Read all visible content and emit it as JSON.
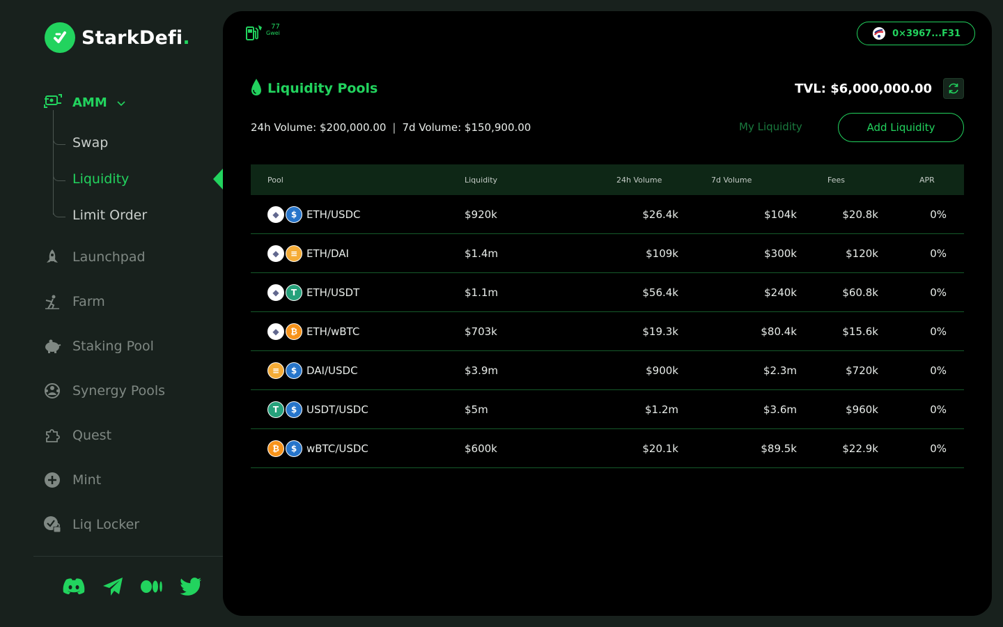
{
  "brand": {
    "name": "StarkDefi",
    "dot": "."
  },
  "sidebar": {
    "amm_label": "AMM",
    "sub_items": [
      {
        "label": "Swap",
        "active": false
      },
      {
        "label": "Liquidity",
        "active": true
      },
      {
        "label": "Limit Order",
        "active": false
      }
    ],
    "items": [
      {
        "label": "Launchpad",
        "icon": "rocket-icon"
      },
      {
        "label": "Farm",
        "icon": "farm-icon"
      },
      {
        "label": "Staking Pool",
        "icon": "piggy-bank-icon"
      },
      {
        "label": "Synergy Pools",
        "icon": "synergy-icon"
      },
      {
        "label": "Quest",
        "icon": "puzzle-icon"
      },
      {
        "label": "Mint",
        "icon": "plus-circle-icon"
      },
      {
        "label": "Liq Locker",
        "icon": "lock-badge-icon"
      }
    ],
    "socials": [
      "discord-icon",
      "telegram-icon",
      "medium-icon",
      "twitter-icon"
    ]
  },
  "header": {
    "gas_value": "77",
    "gas_unit": "Gwei",
    "wallet_address": "0×3967...F31"
  },
  "page": {
    "title": "Liquidity Pools",
    "tvl": "TVL: $6,000,000.00",
    "volume_24h": "24h Volume: $200,000.00",
    "separator": "|",
    "volume_7d": "7d Volume: $150,900.00",
    "my_liquidity": "My Liquidity",
    "add_liquidity": "Add Liquidity"
  },
  "table": {
    "headers": {
      "pool": "Pool",
      "liquidity": "Liquidity",
      "vol24h": "24h Volume",
      "vol7d": "7d Volume",
      "fees": "Fees",
      "apr": "APR"
    },
    "rows": [
      {
        "pool": "ETH/USDC",
        "coins": [
          "eth",
          "usdc"
        ],
        "liquidity": "$920k",
        "vol24h": "$26.4k",
        "vol7d": "$104k",
        "fees": "$20.8k",
        "apr": "0%"
      },
      {
        "pool": "ETH/DAI",
        "coins": [
          "eth",
          "dai"
        ],
        "liquidity": "$1.4m",
        "vol24h": "$109k",
        "vol7d": "$300k",
        "fees": "$120k",
        "apr": "0%"
      },
      {
        "pool": "ETH/USDT",
        "coins": [
          "eth",
          "usdt"
        ],
        "liquidity": "$1.1m",
        "vol24h": "$56.4k",
        "vol7d": "$240k",
        "fees": "$60.8k",
        "apr": "0%"
      },
      {
        "pool": "ETH/wBTC",
        "coins": [
          "eth",
          "wbtc"
        ],
        "liquidity": "$703k",
        "vol24h": "$19.3k",
        "vol7d": "$80.4k",
        "fees": "$15.6k",
        "apr": "0%"
      },
      {
        "pool": "DAI/USDC",
        "coins": [
          "dai",
          "usdc"
        ],
        "liquidity": "$3.9m",
        "vol24h": "$900k",
        "vol7d": "$2.3m",
        "fees": "$720k",
        "apr": "0%"
      },
      {
        "pool": "USDT/USDC",
        "coins": [
          "usdt",
          "usdc"
        ],
        "liquidity": "$5m",
        "vol24h": "$1.2m",
        "vol7d": "$3.6m",
        "fees": "$960k",
        "apr": "0%"
      },
      {
        "pool": "wBTC/USDC",
        "coins": [
          "wbtc",
          "usdc"
        ],
        "liquidity": "$600k",
        "vol24h": "$20.1k",
        "vol7d": "$89.5k",
        "fees": "$22.9k",
        "apr": "0%"
      }
    ]
  },
  "colors": {
    "accent": "#22d35e",
    "panel": "#000000",
    "background": "#18211d",
    "row_border": "#155a2a",
    "header_bg": "#0e2716"
  }
}
